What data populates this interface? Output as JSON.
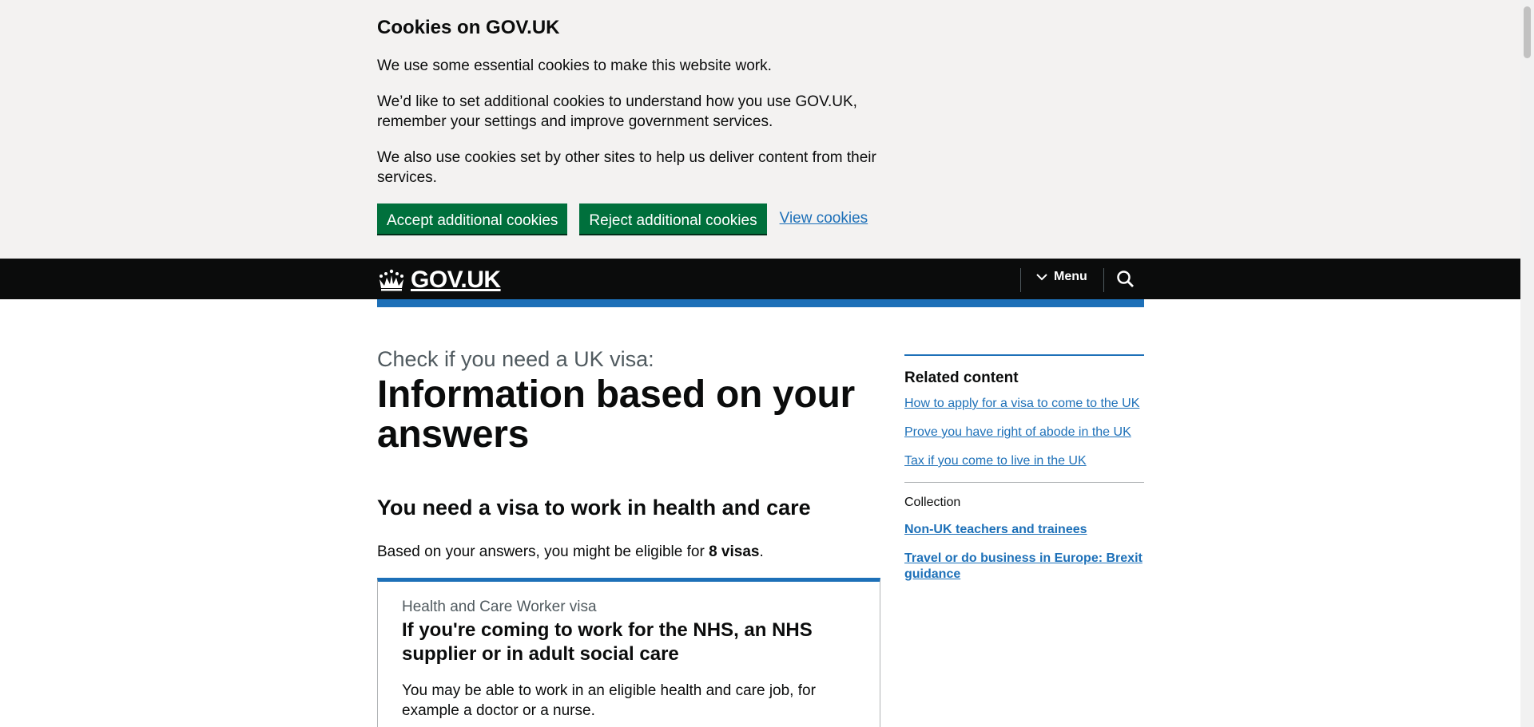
{
  "cookie_banner": {
    "heading": "Cookies on GOV.UK",
    "p1": "We use some essential cookies to make this website work.",
    "p2": "We’d like to set additional cookies to understand how you use GOV.UK, remember your settings and improve government services.",
    "p3": "We also use cookies set by other sites to help us deliver content from their services.",
    "accept_label": "Accept additional cookies",
    "reject_label": "Reject additional cookies",
    "view_label": "View cookies"
  },
  "header": {
    "logo_text": "GOV.UK",
    "menu_label": "Menu",
    "logo_icon": "crown-icon",
    "search_icon": "search-icon"
  },
  "main": {
    "caption": "Check if you need a UK visa:",
    "title": "Information based on your answers",
    "subheading": "You need a visa to work in health and care",
    "lead_prefix": "Based on your answers, you might be eligible for ",
    "lead_bold": "8 visas",
    "lead_suffix": "."
  },
  "visa_card": {
    "caption": "Health and Care Worker visa",
    "title": "If you're coming to work for the NHS, an NHS supplier or in adult social care",
    "description": "You may be able to work in an eligible health and care job, for example a doctor or a nurse."
  },
  "sidebar": {
    "related_heading": "Related content",
    "related_links": [
      "How to apply for a visa to come to the UK",
      "Prove you have right of abode in the UK",
      "Tax if you come to live in the UK"
    ],
    "collection_label": "Collection",
    "collection_links": [
      "Non-UK teachers and trainees",
      "Travel or do business in Europe: Brexit guidance"
    ]
  },
  "colors": {
    "brand_green": "#00703c",
    "link_blue": "#1d70b8",
    "header_black": "#0b0c0c",
    "banner_grey": "#f3f2f1"
  }
}
